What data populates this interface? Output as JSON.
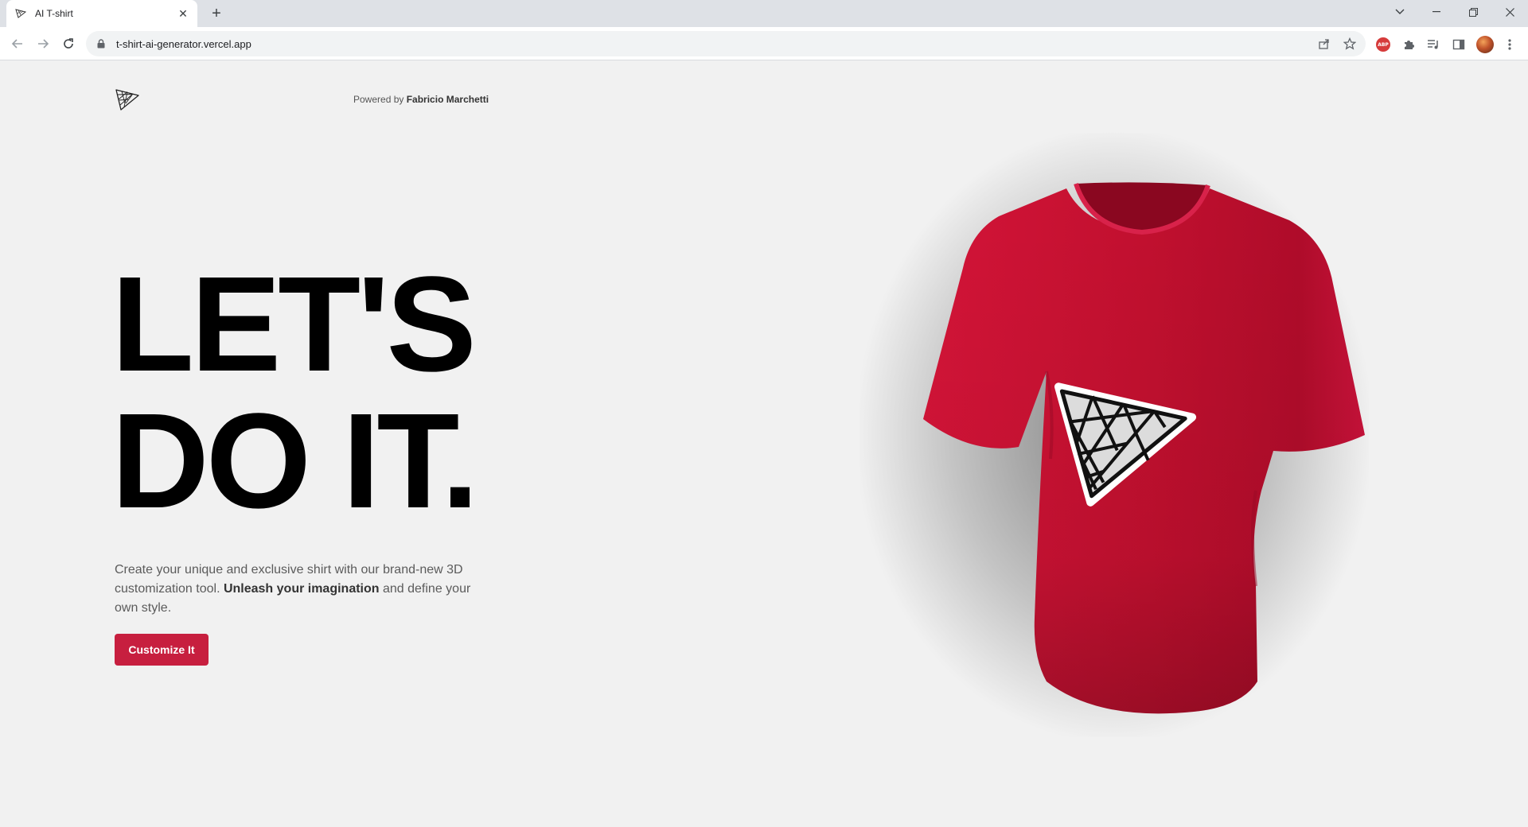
{
  "browser": {
    "tab_title": "AI T-shirt",
    "url": "t-shirt-ai-generator.vercel.app",
    "extension_badge": "ABP"
  },
  "header": {
    "powered_prefix": "Powered by",
    "powered_name": "Fabricio Marchetti"
  },
  "hero": {
    "headline_line1": "LET'S",
    "headline_line2": "DO IT.",
    "desc_part1": "Create your unique and exclusive shirt with our brand-new 3D customization tool. ",
    "desc_bold": "Unleash your imagination",
    "desc_part2": " and define your own style.",
    "cta_label": "Customize It"
  },
  "colors": {
    "accent": "#c71f3f",
    "shirt": "#c8102e",
    "background": "#f1f1f1"
  }
}
